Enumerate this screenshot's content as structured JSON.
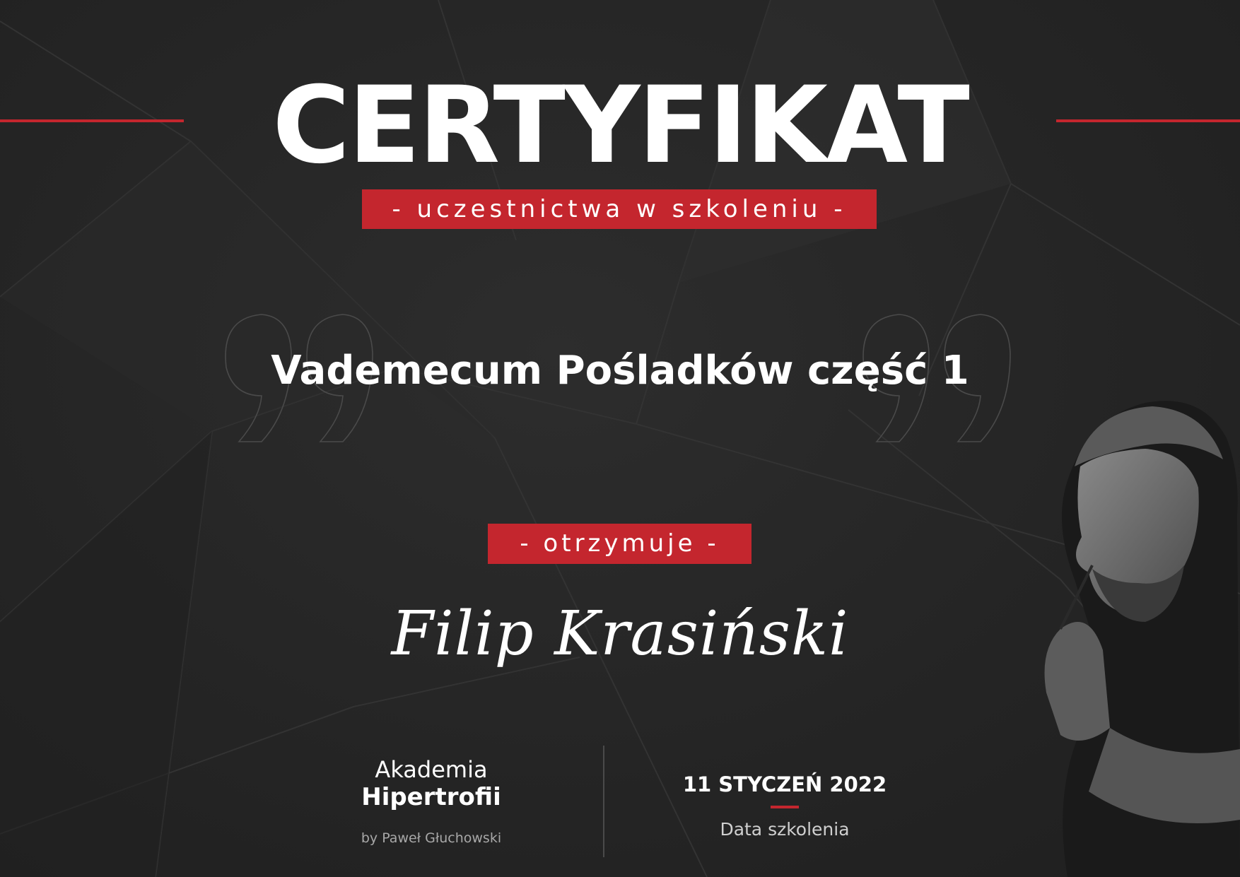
{
  "certificate": {
    "title": "CERTYFIKAT",
    "subtitle": "- uczestnictwa w szkoleniu -",
    "course_name": "Vademecum Pośladków część 1",
    "receives_label": "- otrzymuje -",
    "recipient_name": "Filip Krasiński"
  },
  "footer": {
    "org_line1": "Akademia",
    "org_line2": "Hipertrofii",
    "org_by": "by Paweł Głuchowski",
    "date_value": "11 STYCZEŃ 2022",
    "date_label": "Data szkolenia"
  },
  "colors": {
    "accent": "#c4262e",
    "background": "#262626",
    "text": "#ffffff"
  }
}
